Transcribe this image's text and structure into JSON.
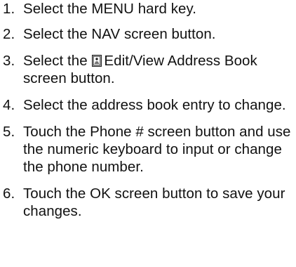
{
  "steps": [
    {
      "number": "1.",
      "text": "Select the MENU hard key."
    },
    {
      "number": "2.",
      "text": "Select the NAV screen button."
    },
    {
      "number": "3.",
      "text_before": "Select the",
      "icon": "address-book-icon",
      "text_after": "Edit/View Address Book screen button."
    },
    {
      "number": "4.",
      "text": "Select the address book entry to change."
    },
    {
      "number": "5.",
      "text": "Touch the Phone # screen button and use the numeric keyboard to input or change the phone number."
    },
    {
      "number": "6.",
      "text": "Touch the OK screen button to save your changes."
    }
  ]
}
